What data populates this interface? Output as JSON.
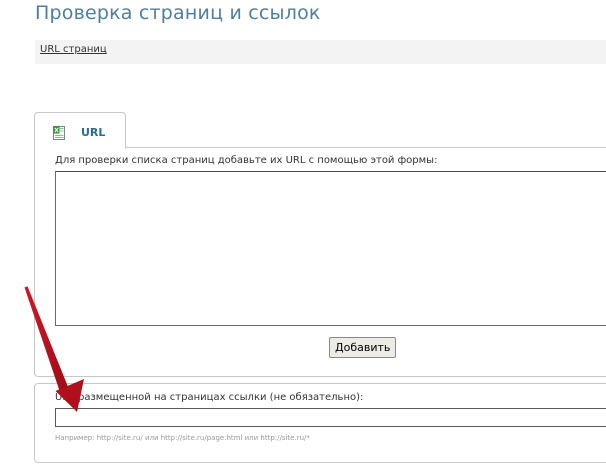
{
  "page": {
    "title": "Проверка страниц и ссылок"
  },
  "subnav": {
    "link_label": "URL страниц"
  },
  "tab": {
    "label": "URL",
    "icon": "excel-file-icon"
  },
  "url_form": {
    "label": "Для проверки списка страниц добавьте их URL с помощью этой формы:",
    "textarea_value": "",
    "add_button_label": "Добавить"
  },
  "link_form": {
    "label": "URL размещенной на страницах ссылки (не обязательно):",
    "input_value": "",
    "hint": "Например: http://site.ru/ или http://site.ru/page.html или http://site.ru/*"
  },
  "colors": {
    "title": "#4d7fa0",
    "tab_label": "#2c6b95",
    "arrow": "#b0101c"
  }
}
